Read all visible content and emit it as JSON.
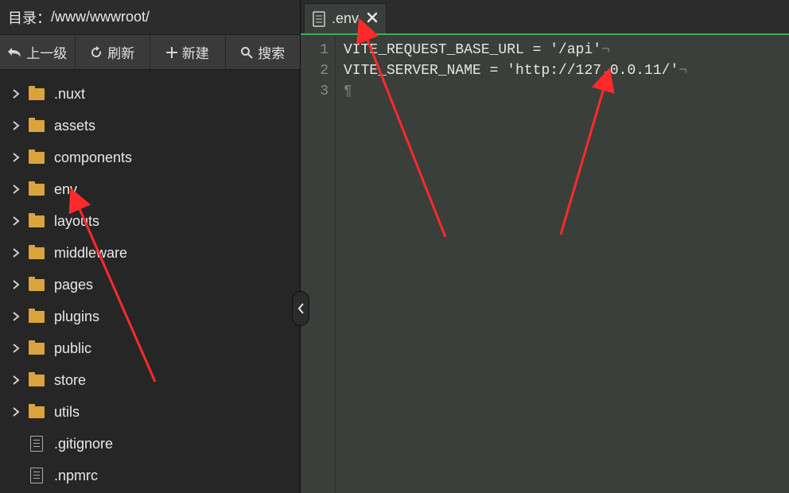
{
  "path_bar": {
    "label": "目录：",
    "path": "/www/wwwroot/"
  },
  "toolbar": {
    "up": "上一级",
    "refresh": "刷新",
    "create": "新建",
    "search": "搜索"
  },
  "tree": [
    {
      "type": "folder",
      "label": ".nuxt"
    },
    {
      "type": "folder",
      "label": "assets"
    },
    {
      "type": "folder",
      "label": "components"
    },
    {
      "type": "folder",
      "label": "env"
    },
    {
      "type": "folder",
      "label": "layouts"
    },
    {
      "type": "folder",
      "label": "middleware"
    },
    {
      "type": "folder",
      "label": "pages"
    },
    {
      "type": "folder",
      "label": "plugins"
    },
    {
      "type": "folder",
      "label": "public"
    },
    {
      "type": "folder",
      "label": "store"
    },
    {
      "type": "folder",
      "label": "utils"
    },
    {
      "type": "file",
      "label": ".gitignore"
    },
    {
      "type": "file",
      "label": ".npmrc"
    }
  ],
  "tab": {
    "title": ".env"
  },
  "code": {
    "lines": [
      "VITE_REQUEST_BASE_URL = '/api'",
      "VITE_SERVER_NAME = 'http://127.0.0.11/'",
      ""
    ]
  }
}
